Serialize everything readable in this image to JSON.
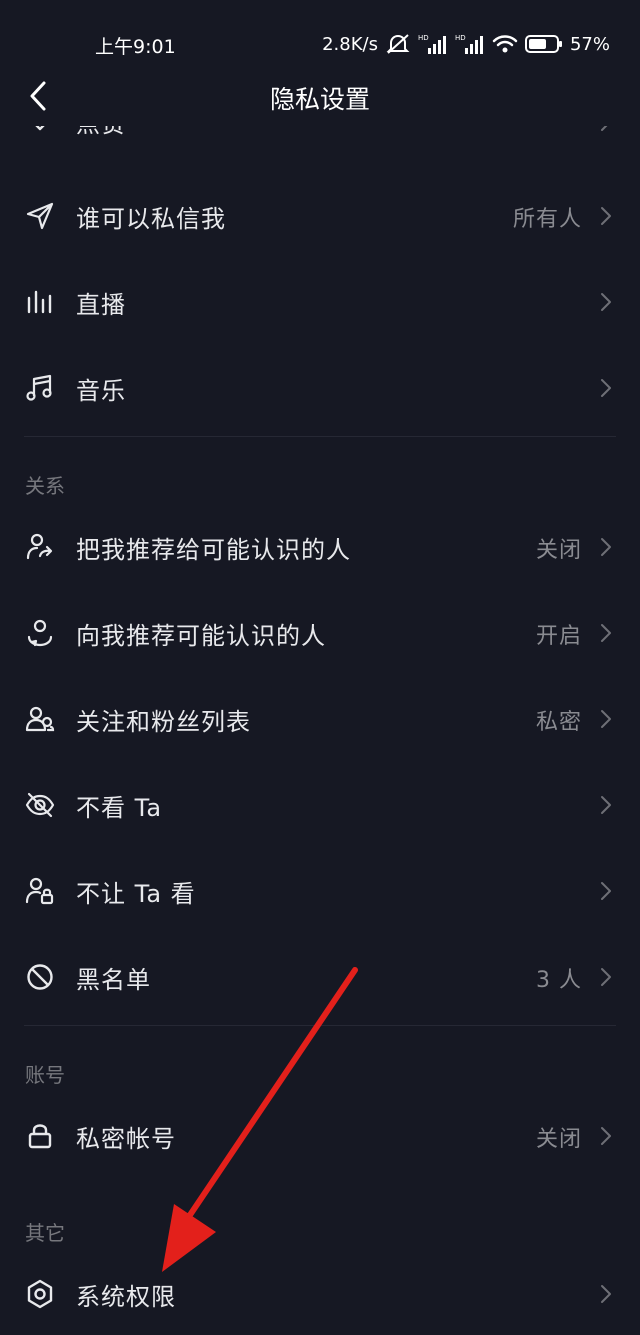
{
  "status_bar": {
    "time": "上午9:01",
    "network_speed": "2.8K/s",
    "battery": "57%"
  },
  "header": {
    "title": "隐私设置"
  },
  "partial_item": {
    "label": "点赞"
  },
  "sections": {
    "relations_header": "关系",
    "account_header": "账号",
    "other_header": "其它"
  },
  "items": {
    "who_can_message": {
      "label": "谁可以私信我",
      "value": "所有人"
    },
    "live": {
      "label": "直播"
    },
    "music": {
      "label": "音乐"
    },
    "recommend_me": {
      "label": "把我推荐给可能认识的人",
      "value": "关闭"
    },
    "recommend_to_me": {
      "label": "向我推荐可能认识的人",
      "value": "开启"
    },
    "follow_fans_list": {
      "label": "关注和粉丝列表",
      "value": "私密"
    },
    "dont_watch": {
      "label": "不看 Ta"
    },
    "dont_let_watch": {
      "label": "不让 Ta 看"
    },
    "blacklist": {
      "label": "黑名单",
      "value": "3 人"
    },
    "private_account": {
      "label": "私密帐号",
      "value": "关闭"
    },
    "system_permissions": {
      "label": "系统权限"
    }
  },
  "colors": {
    "background": "#161823",
    "text": "#e8e9ec",
    "secondary_text": "#8a8b91",
    "annotation_arrow": "#e3201b"
  }
}
